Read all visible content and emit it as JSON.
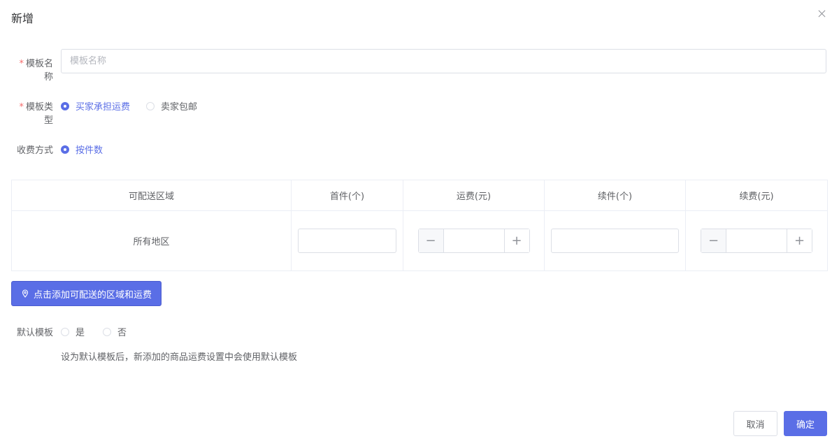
{
  "dialog": {
    "title": "新增"
  },
  "form": {
    "template_name": {
      "label": "模板名称",
      "required_mark": "*",
      "value": "",
      "placeholder": "模板名称"
    },
    "template_type": {
      "label": "模板类型",
      "required_mark": "*",
      "options": [
        {
          "label": "买家承担运费",
          "checked": true
        },
        {
          "label": "卖家包邮",
          "checked": false
        }
      ]
    },
    "charge_method": {
      "label": "收费方式",
      "options": [
        {
          "label": "按件数",
          "checked": true
        }
      ]
    },
    "default_template": {
      "label": "默认模板",
      "options": [
        {
          "label": "是",
          "checked": false
        },
        {
          "label": "否",
          "checked": false
        }
      ],
      "hint": "设为默认模板后，新添加的商品运费设置中会使用默认模板"
    }
  },
  "fee_table": {
    "headers": [
      "可配送区域",
      "首件(个)",
      "运费(元)",
      "续件(个)",
      "续费(元)"
    ],
    "rows": [
      {
        "region": "所有地区",
        "first_item": "",
        "freight": "",
        "extra_item": "",
        "extra_fee": ""
      }
    ]
  },
  "add_region_button": {
    "label": "点击添加可配送的区域和运费",
    "icon": "location-pin-icon"
  },
  "footer": {
    "cancel_label": "取消",
    "confirm_label": "确定"
  },
  "colors": {
    "primary": "#5a6ee6",
    "required": "#f56c6c",
    "border": "#dcdfe6"
  }
}
